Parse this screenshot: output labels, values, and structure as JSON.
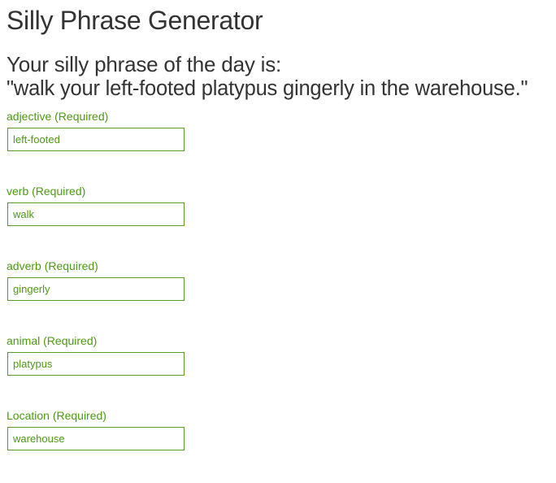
{
  "header": {
    "title": "Silly Phrase Generator"
  },
  "phrase": {
    "intro": "Your silly phrase of the day is:",
    "text": "\"walk your left-footed platypus gingerly in the warehouse.\""
  },
  "form": {
    "fields": [
      {
        "label": "adjective (Required)",
        "value": "left-footed"
      },
      {
        "label": "verb (Required)",
        "value": "walk"
      },
      {
        "label": "adverb (Required)",
        "value": "gingerly"
      },
      {
        "label": "animal (Required)",
        "value": "platypus"
      },
      {
        "label": "Location (Required)",
        "value": "warehouse"
      }
    ]
  },
  "colors": {
    "text": "#333333",
    "accent_green": "#4d9a14",
    "input_border": "#5a9e1d",
    "background": "#ffffff"
  }
}
